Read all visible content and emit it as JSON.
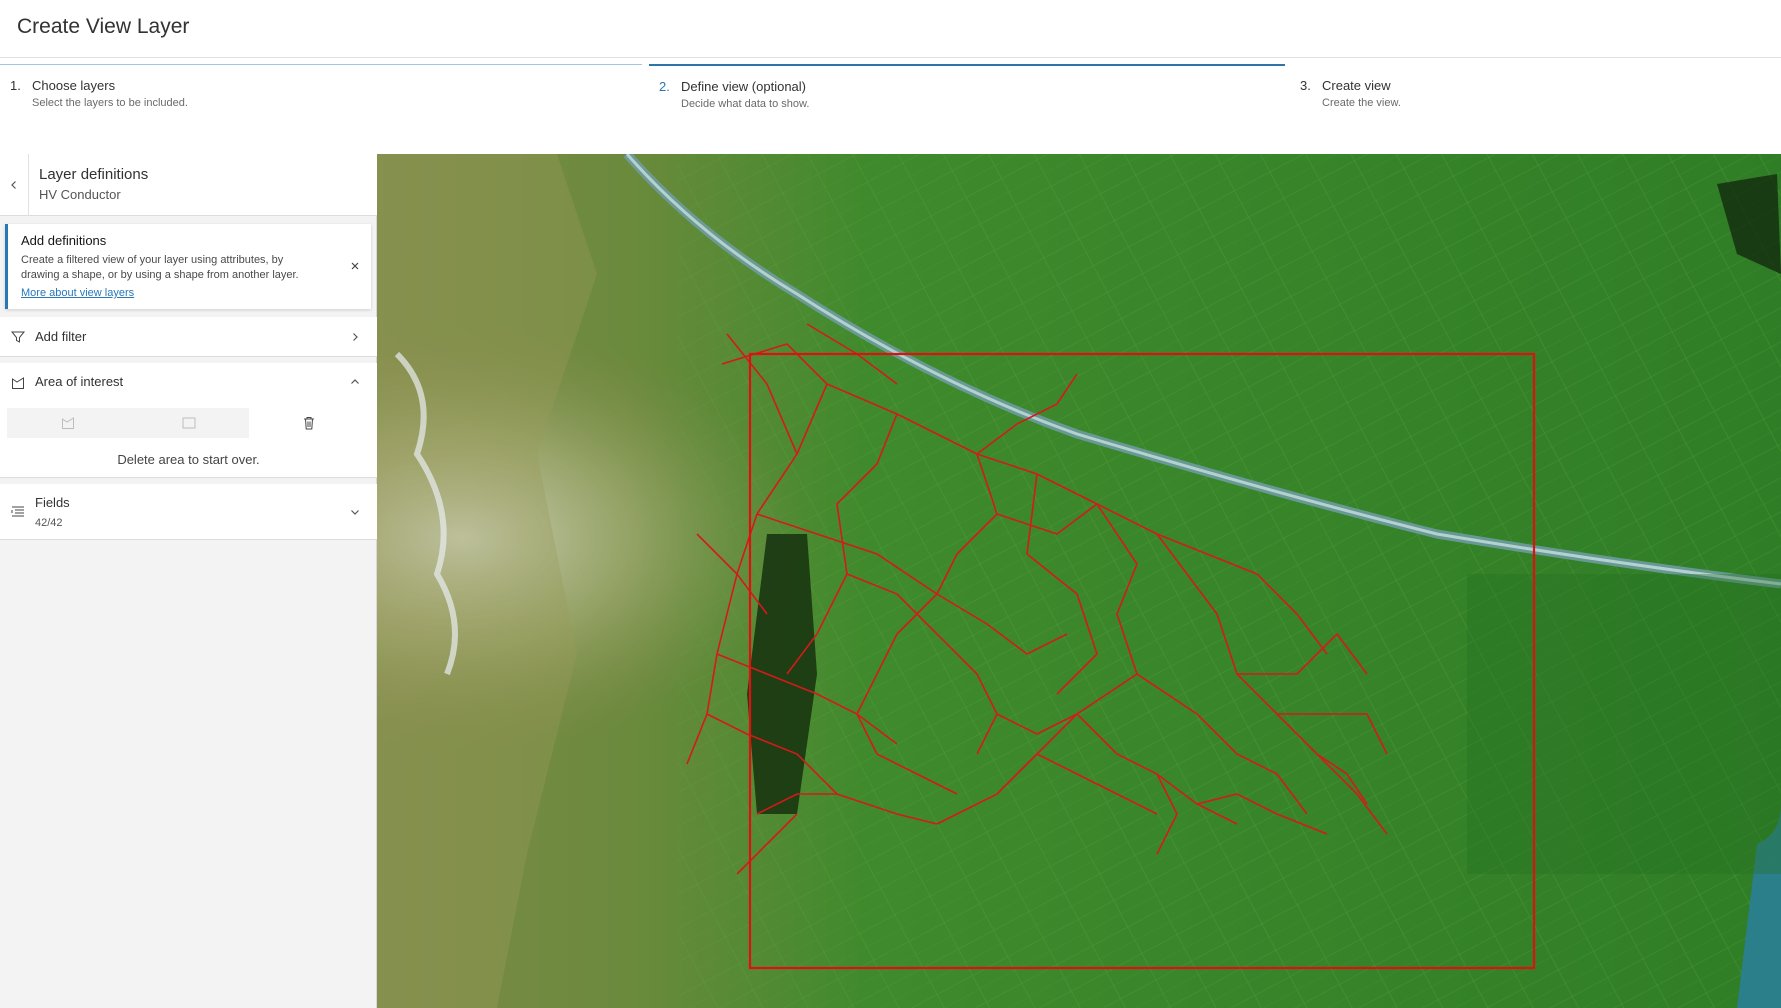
{
  "page": {
    "title": "Create View Layer"
  },
  "steps": [
    {
      "num": "1.",
      "label": "Choose layers",
      "desc": "Select the layers to be included."
    },
    {
      "num": "2.",
      "label": "Define view (optional)",
      "desc": "Decide what data to show."
    },
    {
      "num": "3.",
      "label": "Create view",
      "desc": "Create the view."
    }
  ],
  "panel": {
    "title": "Layer definitions",
    "subtitle": "HV Conductor",
    "notice": {
      "title": "Add definitions",
      "text": "Create a filtered view of your layer using attributes, by drawing a shape, or by using a shape from another layer.",
      "link": "More about view layers"
    },
    "add_filter": "Add filter",
    "aoi": {
      "label": "Area of interest",
      "message": "Delete area to start over."
    },
    "fields": {
      "label": "Fields",
      "count": "42/42"
    }
  },
  "colors": {
    "accent": "#2878b8",
    "aoi_outline": "#e01010",
    "conductor_lines": "#d41a1a"
  },
  "icons": [
    "chevron-left-icon",
    "close-icon",
    "filter-icon",
    "chevron-right-icon",
    "polygon-icon",
    "chevron-up-icon",
    "freehand-polygon-icon",
    "rectangle-icon",
    "trash-icon",
    "fields-list-icon",
    "chevron-down-icon"
  ]
}
